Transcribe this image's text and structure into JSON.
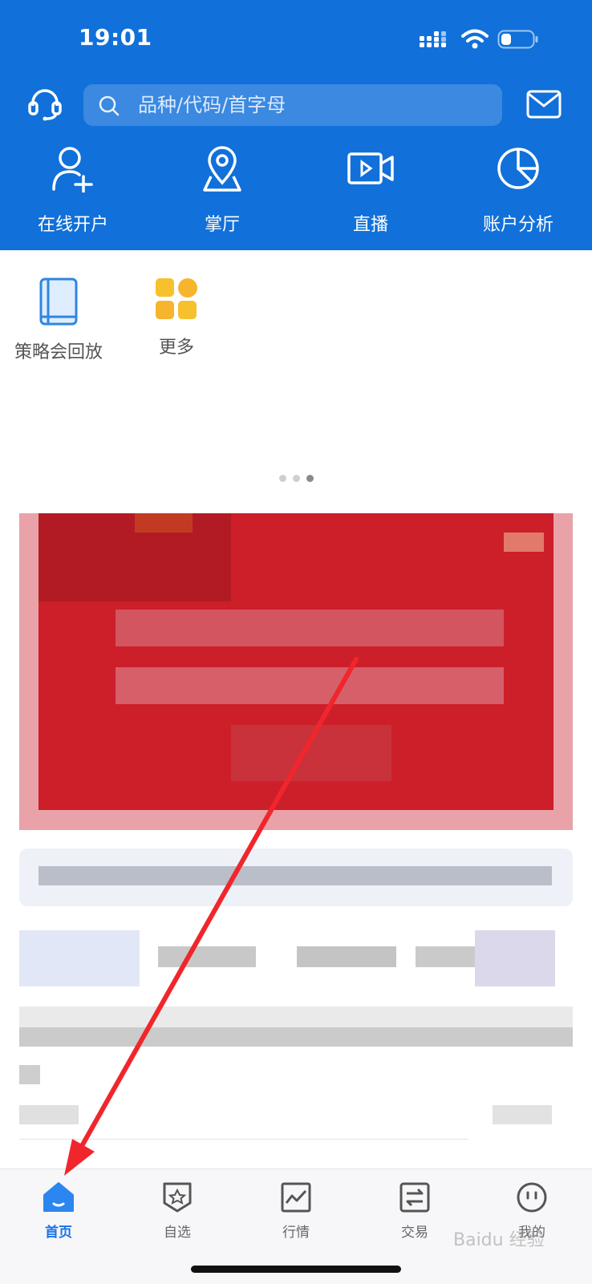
{
  "status_bar": {
    "time": "19:01"
  },
  "search": {
    "placeholder": "品种/代码/首字母"
  },
  "quick_actions": [
    {
      "label": "在线开户",
      "icon": "add-user-icon"
    },
    {
      "label": "掌厅",
      "icon": "location-pin-icon"
    },
    {
      "label": "直播",
      "icon": "video-icon"
    },
    {
      "label": "账户分析",
      "icon": "pie-chart-icon"
    }
  ],
  "shortcuts": [
    {
      "label": "策略会回放",
      "icon": "book-icon"
    },
    {
      "label": "更多",
      "icon": "grid-icon"
    }
  ],
  "carousel": {
    "count": 3,
    "active": 2
  },
  "bottom_nav": [
    {
      "label": "首页",
      "icon": "home-icon",
      "active": true
    },
    {
      "label": "自选",
      "icon": "star-badge-icon"
    },
    {
      "label": "行情",
      "icon": "trend-chart-icon"
    },
    {
      "label": "交易",
      "icon": "exchange-icon"
    },
    {
      "label": "我的",
      "icon": "smiley-icon"
    }
  ],
  "watermark": "Baidu 经验",
  "colors": {
    "brand_blue": "#1170d9",
    "banner_red": "#cc1f2a",
    "active_tab": "#1a73e8",
    "annotation_arrow": "#f0262c"
  }
}
